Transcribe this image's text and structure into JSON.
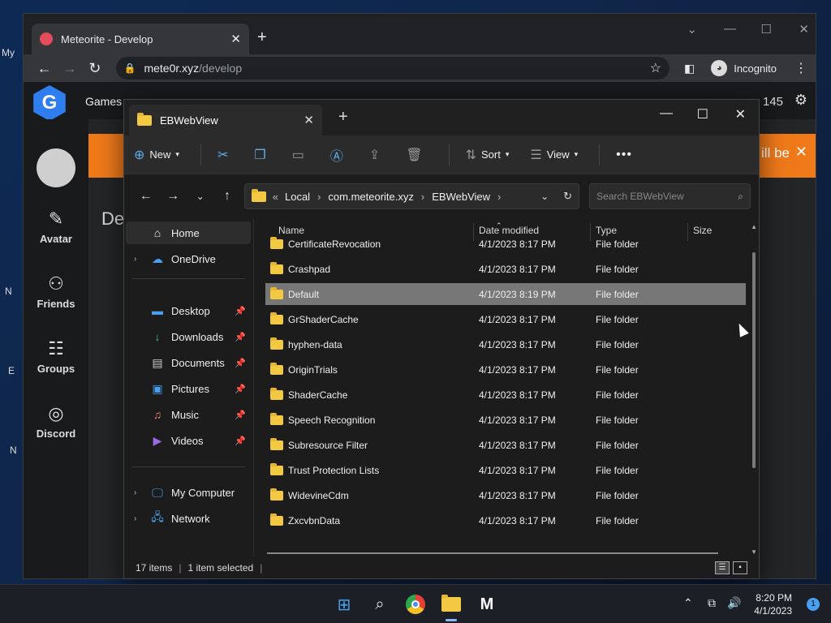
{
  "desktop": {
    "labels": [
      "My",
      "N",
      "E",
      "N"
    ]
  },
  "browser": {
    "tab_title": "Meteorite - Develop",
    "url_host": "mete0r.xyz",
    "url_path": "/develop",
    "incognito_label": "Incognito"
  },
  "site": {
    "nav_games": "Games",
    "count": "145",
    "banner_text": "ill be",
    "heading": "De",
    "sidebar": [
      {
        "label": "Avatar",
        "icon": "brush-icon"
      },
      {
        "label": "Friends",
        "icon": "friends-icon"
      },
      {
        "label": "Groups",
        "icon": "groups-icon"
      },
      {
        "label": "Discord",
        "icon": "discord-icon"
      }
    ]
  },
  "explorer": {
    "tab_title": "EBWebView",
    "toolbar": {
      "new": "New",
      "sort": "Sort",
      "view": "View"
    },
    "path": {
      "prefix": "«",
      "crumbs": [
        "Local",
        "com.meteorite.xyz",
        "EBWebView"
      ]
    },
    "search_placeholder": "Search EBWebView",
    "nav": {
      "home": "Home",
      "onedrive": "OneDrive",
      "quick": [
        {
          "label": "Desktop",
          "icon": "desktop-icon"
        },
        {
          "label": "Downloads",
          "icon": "downloads-icon"
        },
        {
          "label": "Documents",
          "icon": "documents-icon"
        },
        {
          "label": "Pictures",
          "icon": "pictures-icon"
        },
        {
          "label": "Music",
          "icon": "music-icon"
        },
        {
          "label": "Videos",
          "icon": "videos-icon"
        }
      ],
      "my_computer": "My Computer",
      "network": "Network"
    },
    "columns": {
      "name": "Name",
      "date": "Date modified",
      "type": "Type",
      "size": "Size"
    },
    "rows": [
      {
        "name": "CertificateRevocation",
        "date": "4/1/2023 8:17 PM",
        "type": "File folder",
        "selected": false
      },
      {
        "name": "Crashpad",
        "date": "4/1/2023 8:17 PM",
        "type": "File folder",
        "selected": false
      },
      {
        "name": "Default",
        "date": "4/1/2023 8:19 PM",
        "type": "File folder",
        "selected": true
      },
      {
        "name": "GrShaderCache",
        "date": "4/1/2023 8:17 PM",
        "type": "File folder",
        "selected": false
      },
      {
        "name": "hyphen-data",
        "date": "4/1/2023 8:17 PM",
        "type": "File folder",
        "selected": false
      },
      {
        "name": "OriginTrials",
        "date": "4/1/2023 8:17 PM",
        "type": "File folder",
        "selected": false
      },
      {
        "name": "ShaderCache",
        "date": "4/1/2023 8:17 PM",
        "type": "File folder",
        "selected": false
      },
      {
        "name": "Speech Recognition",
        "date": "4/1/2023 8:17 PM",
        "type": "File folder",
        "selected": false
      },
      {
        "name": "Subresource Filter",
        "date": "4/1/2023 8:17 PM",
        "type": "File folder",
        "selected": false
      },
      {
        "name": "Trust Protection Lists",
        "date": "4/1/2023 8:17 PM",
        "type": "File folder",
        "selected": false
      },
      {
        "name": "WidevineCdm",
        "date": "4/1/2023 8:17 PM",
        "type": "File folder",
        "selected": false
      },
      {
        "name": "ZxcvbnData",
        "date": "4/1/2023 8:17 PM",
        "type": "File folder",
        "selected": false
      }
    ],
    "status": {
      "items": "17 items",
      "selected": "1 item selected"
    }
  },
  "taskbar": {
    "time": "8:20 PM",
    "date": "4/1/2023",
    "notifications": "1"
  },
  "colors": {
    "accent": "#60b0f0",
    "banner": "#f07a1a",
    "folder": "#f3c843",
    "selection": "#777777"
  }
}
